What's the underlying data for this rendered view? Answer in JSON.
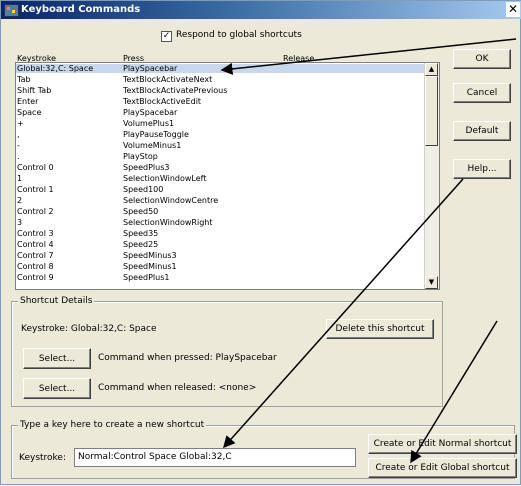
{
  "window": {
    "title": "Keyboard Commands",
    "close_glyph": "✕"
  },
  "options": {
    "respond_global_label": "Respond to global shortcuts",
    "respond_global_checked": true,
    "check_glyph": "✓"
  },
  "columns": {
    "keystroke": "Keystroke",
    "press": "Press",
    "release": "Release"
  },
  "shortcuts": [
    {
      "keystroke": "Global:32,C:  Space",
      "press": "PlaySpacebar",
      "selected": true
    },
    {
      "keystroke": "Tab",
      "press": "TextBlockActivateNext"
    },
    {
      "keystroke": "Shift Tab",
      "press": "TextBlockActivatePrevious"
    },
    {
      "keystroke": "Enter",
      "press": "TextBlockActiveEdit"
    },
    {
      "keystroke": "Space",
      "press": "PlaySpacebar"
    },
    {
      "keystroke": "+",
      "press": "VolumePlus1"
    },
    {
      "keystroke": ",",
      "press": "PlayPauseToggle"
    },
    {
      "keystroke": "-",
      "press": "VolumeMinus1"
    },
    {
      "keystroke": ".",
      "press": "PlayStop"
    },
    {
      "keystroke": "Control 0",
      "press": "SpeedPlus3"
    },
    {
      "keystroke": "1",
      "press": "SelectionWindowLeft"
    },
    {
      "keystroke": "Control 1",
      "press": "Speed100"
    },
    {
      "keystroke": "2",
      "press": "SelectionWindowCentre"
    },
    {
      "keystroke": "Control 2",
      "press": "Speed50"
    },
    {
      "keystroke": "3",
      "press": "SelectionWindowRight"
    },
    {
      "keystroke": "Control 3",
      "press": "Speed35"
    },
    {
      "keystroke": "Control 4",
      "press": "Speed25"
    },
    {
      "keystroke": "Control 7",
      "press": "SpeedMinus3"
    },
    {
      "keystroke": "Control 8",
      "press": "SpeedMinus1"
    },
    {
      "keystroke": "Control 9",
      "press": "SpeedPlus1"
    }
  ],
  "scrollbar": {
    "up_glyph": "▲",
    "down_glyph": "▼"
  },
  "buttons": {
    "ok": "OK",
    "cancel": "Cancel",
    "default": "Default",
    "help": "Help..."
  },
  "details": {
    "legend": "Shortcut Details",
    "keystroke_text": "Keystroke: Global:32,C:  Space",
    "delete_label": "Delete this shortcut",
    "select_label": "Select...",
    "pressed_text": "Command when pressed: PlaySpacebar",
    "released_text": "Command when released: <none>"
  },
  "create": {
    "legend": "Type a key here to create a new shortcut",
    "keystroke_label": "Keystroke:",
    "input_value": "Normal:Control Space  Global:32,C",
    "normal_button": "Create or Edit Normal shortcut",
    "global_button": "Create or Edit Global shortcut"
  }
}
